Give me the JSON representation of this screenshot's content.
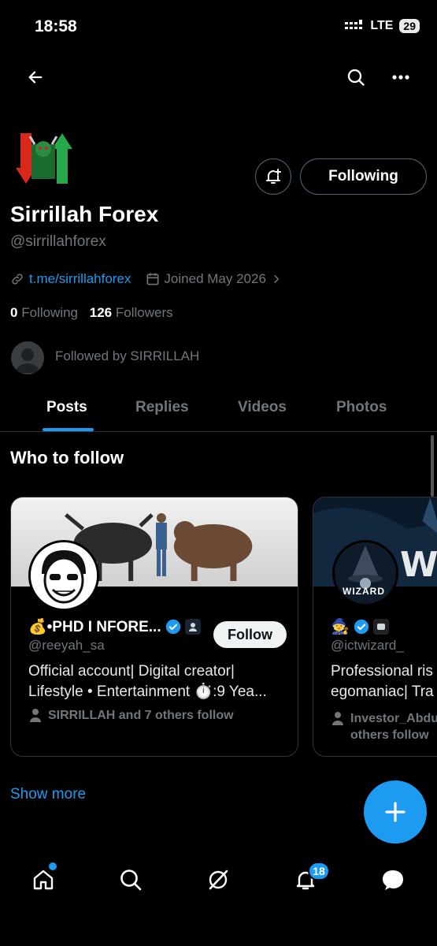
{
  "status_bar": {
    "time": "18:58",
    "network": "LTE",
    "battery": "29"
  },
  "top_nav": {
    "back_icon": "arrow-left-icon",
    "search_icon": "search-icon",
    "more_icon": "more-horizontal-icon"
  },
  "profile": {
    "name": "Sirrillah Forex",
    "handle": "@sirrillahforex",
    "link": "t.me/sirrillahforex",
    "joined": "Joined May 2026",
    "following_count": "0",
    "following_label": "Following",
    "followers_count": "126",
    "followers_label": "Followers",
    "followed_by": "Followed by SIRRILLAH",
    "follow_state_label": "Following"
  },
  "tabs": [
    {
      "label": "Posts",
      "active": true
    },
    {
      "label": "Replies",
      "active": false
    },
    {
      "label": "Videos",
      "active": false
    },
    {
      "label": "Photos",
      "active": false
    }
  ],
  "who_to_follow": {
    "title": "Who to follow",
    "cards": [
      {
        "name": "💰•PHD I NFORE...",
        "handle": "@reeyah_sa",
        "bio_line1": "Official account| Digital creator|",
        "bio_line2": "Lifestyle • Entertainment ⏱️:9 Yea...",
        "followers_note": "SIRRILLAH and 7 others follow",
        "follow_label": "Follow"
      },
      {
        "name": "🧙",
        "handle": "@ictwizard_",
        "bio_line1": "Professional ris",
        "bio_line2": "egomaniac| Tra",
        "followers_note_line1": "Investor_Abdu",
        "followers_note_line2": "others follow",
        "banner_text": "WI",
        "avatar_text": "WIZARD"
      }
    ],
    "show_more": "Show more"
  },
  "fab": {
    "icon": "plus-icon"
  },
  "bottom_nav": {
    "items": [
      "home-icon",
      "search-icon",
      "grok-icon",
      "notifications-icon",
      "messages-icon"
    ],
    "notifications_badge": "18"
  },
  "colors": {
    "accent": "#1d9bf0",
    "background": "#000000",
    "muted": "#71767b"
  }
}
